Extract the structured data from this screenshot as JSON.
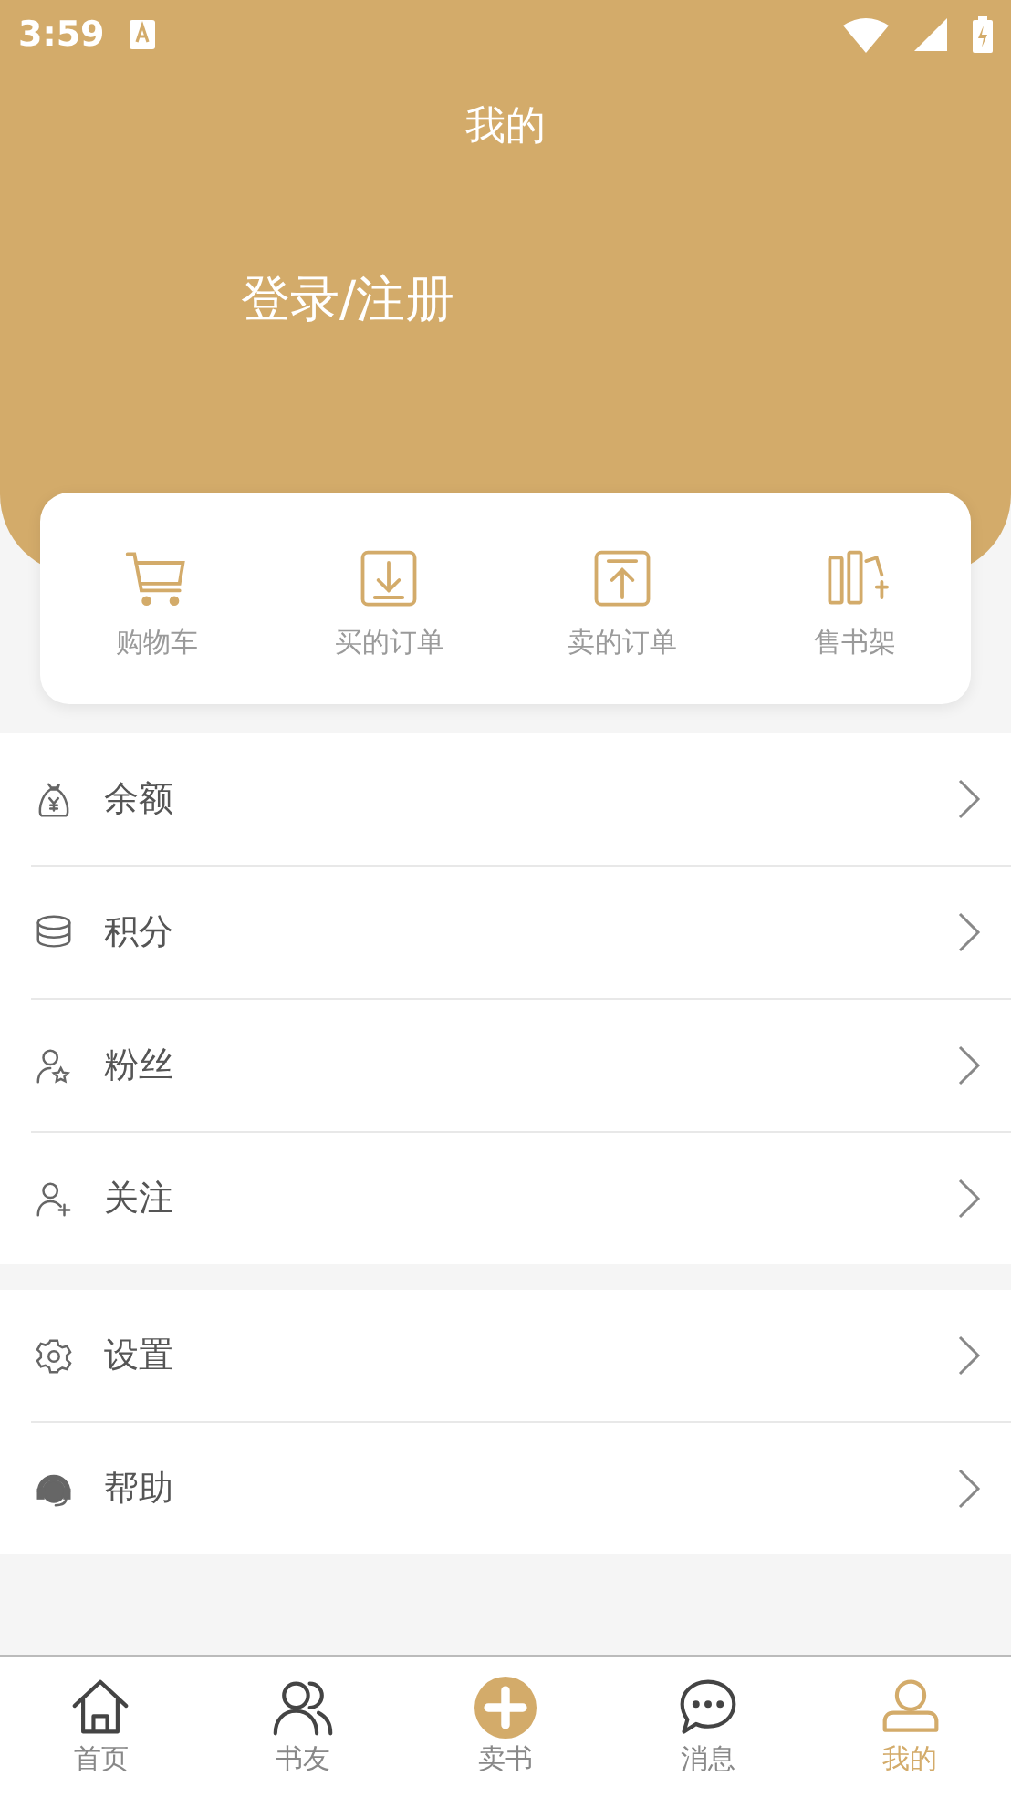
{
  "status_bar": {
    "time": "3:59"
  },
  "header": {
    "title": "我的",
    "login": "登录/注册"
  },
  "shortcuts": [
    {
      "kind": "cart",
      "label": "购物车"
    },
    {
      "kind": "download",
      "label": "买的订单"
    },
    {
      "kind": "upload",
      "label": "卖的订单"
    },
    {
      "kind": "shelf",
      "label": "售书架"
    }
  ],
  "menu_groups": [
    [
      {
        "kind": "money",
        "label": "余额"
      },
      {
        "kind": "coins",
        "label": "积分"
      },
      {
        "kind": "fans",
        "label": "粉丝"
      },
      {
        "kind": "follow",
        "label": "关注"
      }
    ],
    [
      {
        "kind": "settings",
        "label": "设置"
      },
      {
        "kind": "help",
        "label": "帮助"
      }
    ]
  ],
  "tab_bar": [
    {
      "kind": "home",
      "label": "首页",
      "selected": false
    },
    {
      "kind": "friends",
      "label": "书友",
      "selected": false
    },
    {
      "kind": "sell",
      "label": "卖书",
      "selected": false
    },
    {
      "kind": "messages",
      "label": "消息",
      "selected": false
    },
    {
      "kind": "me",
      "label": "我的",
      "selected": true
    }
  ]
}
